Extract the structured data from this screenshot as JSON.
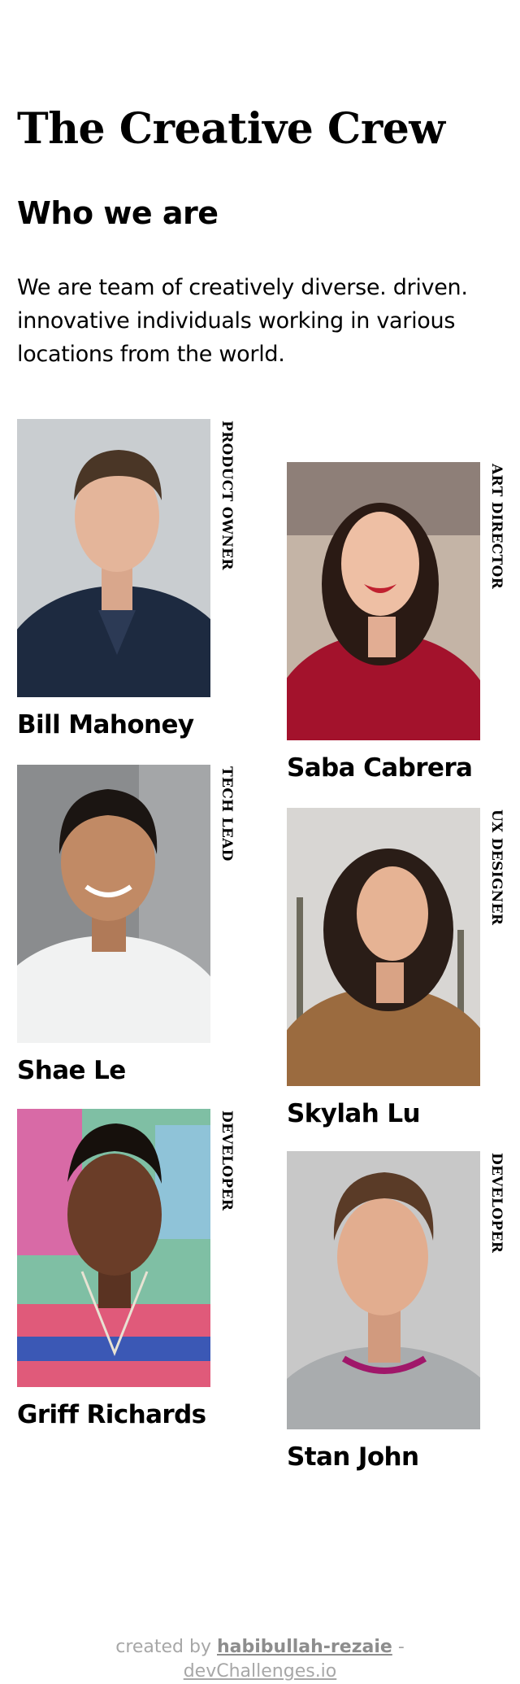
{
  "header": {
    "title": "The Creative Crew",
    "subtitle": "Who we are",
    "intro": "We are team of creatively diverse. driven. innovative individuals working in various locations from the world."
  },
  "members": [
    {
      "name": "Bill Mahoney",
      "role": "PRODUCT OWNER"
    },
    {
      "name": "Saba Cabrera",
      "role": "ART DIRECTOR"
    },
    {
      "name": "Shae Le",
      "role": "TECH LEAD"
    },
    {
      "name": "Skylah Lu",
      "role": "UX DESIGNER"
    },
    {
      "name": "Griff Richards",
      "role": "DEVELOPER"
    },
    {
      "name": "Stan John",
      "role": "DEVELOPER"
    }
  ],
  "footer": {
    "prefix": "created by",
    "author": "habibullah-rezaie",
    "separator": "-",
    "site": "devChallenges.io"
  }
}
